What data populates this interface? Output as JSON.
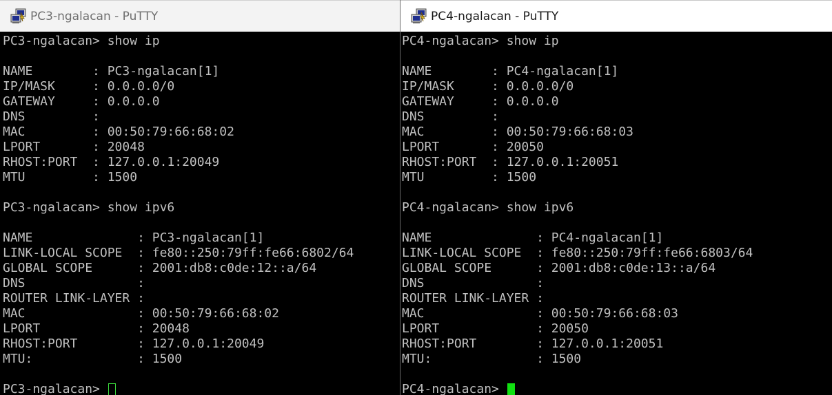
{
  "left_window": {
    "title": "PC3-ngalacan - PuTTY",
    "lines": [
      "PC3-ngalacan> show ip",
      "",
      "NAME        : PC3-ngalacan[1]",
      "IP/MASK     : 0.0.0.0/0",
      "GATEWAY     : 0.0.0.0",
      "DNS         :",
      "MAC         : 00:50:79:66:68:02",
      "LPORT       : 20048",
      "RHOST:PORT  : 127.0.0.1:20049",
      "MTU         : 1500",
      "",
      "PC3-ngalacan> show ipv6",
      "",
      "NAME              : PC3-ngalacan[1]",
      "LINK-LOCAL SCOPE  : fe80::250:79ff:fe66:6802/64",
      "GLOBAL SCOPE      : 2001:db8:c0de:12::a/64",
      "DNS               :",
      "ROUTER LINK-LAYER :",
      "MAC               : 00:50:79:66:68:02",
      "LPORT             : 20048",
      "RHOST:PORT        : 127.0.0.1:20049",
      "MTU:              : 1500",
      ""
    ],
    "prompt": "PC3-ngalacan> "
  },
  "right_window": {
    "title": "PC4-ngalacan - PuTTY",
    "lines": [
      "PC4-ngalacan> show ip",
      "",
      "NAME        : PC4-ngalacan[1]",
      "IP/MASK     : 0.0.0.0/0",
      "GATEWAY     : 0.0.0.0",
      "DNS         :",
      "MAC         : 00:50:79:66:68:03",
      "LPORT       : 20050",
      "RHOST:PORT  : 127.0.0.1:20051",
      "MTU         : 1500",
      "",
      "PC4-ngalacan> show ipv6",
      "",
      "NAME              : PC4-ngalacan[1]",
      "LINK-LOCAL SCOPE  : fe80::250:79ff:fe66:6803/64",
      "GLOBAL SCOPE      : 2001:db8:c0de:13::a/64",
      "DNS               :",
      "ROUTER LINK-LAYER :",
      "MAC               : 00:50:79:66:68:03",
      "LPORT             : 20050",
      "RHOST:PORT        : 127.0.0.1:20051",
      "MTU:              : 1500",
      ""
    ],
    "prompt": "PC4-ngalacan> "
  },
  "colors": {
    "terminal_bg": "#000000",
    "terminal_fg": "#c0c0c0",
    "cursor_active": "#11e011",
    "cursor_inactive": "#3cdc3c"
  }
}
